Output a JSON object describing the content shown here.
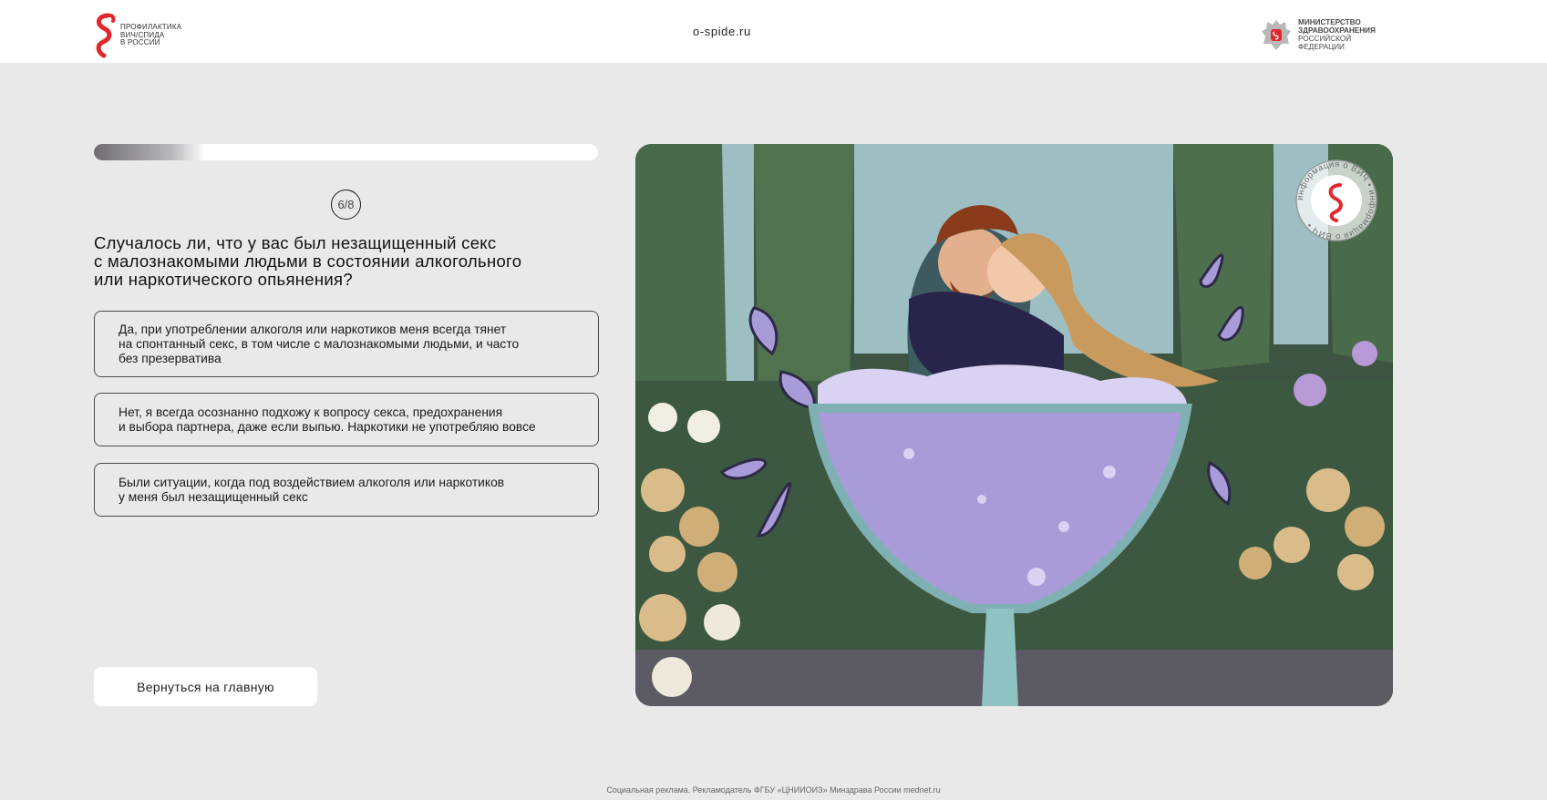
{
  "header": {
    "logo_left_lines": [
      "ПРОФИЛАКТИКА",
      "ВИЧ/СПИДа",
      "В РОССИИ"
    ],
    "site_url": "o-spide.ru",
    "ministry_lines": [
      "МИНИСТЕРСТВО",
      "ЗДРАВООХРАНЕНИЯ",
      "РОССИЙСКОЙ ФЕДЕРАЦИИ"
    ]
  },
  "quiz": {
    "progress": 0.22,
    "step": "6/8",
    "question": "Случалось ли, что у вас был незащищенный секс\nс малознакомыми людьми в состоянии алкогольного\nили наркотического опьянения?",
    "options": [
      {
        "label": "Да, при употреблении алкоголя или наркотиков меня всегда тянет\nна спонтанный секс, в том числе с малознакомыми людьми, и часто\nбез презерватива"
      },
      {
        "label": "Нет, я всегда осознанно подхожу к вопросу секса, предохранения\nи выбора партнера, даже если выпью. Наркотики не употребляю вовсе"
      },
      {
        "label": "Были ситуации, когда под воздействием алкоголя или наркотиков\nу меня был незащищенный секс"
      }
    ],
    "back_label": "Вернуться на главную"
  },
  "illustration": {
    "stamp_text": "информация о ВИЧ • информация о ВИЧ •"
  },
  "footer": {
    "text": "Социальная реклама. Рекламодатель ФГБУ «ЦНИИОИЗ» Минздрава России mednet.ru"
  },
  "colors": {
    "page_bg": "#e9e9e9",
    "accent_red": "#e3262b",
    "foliage": "#3e5442",
    "sky": "#9dbfc4",
    "glass_purple": "#a99bd8"
  }
}
